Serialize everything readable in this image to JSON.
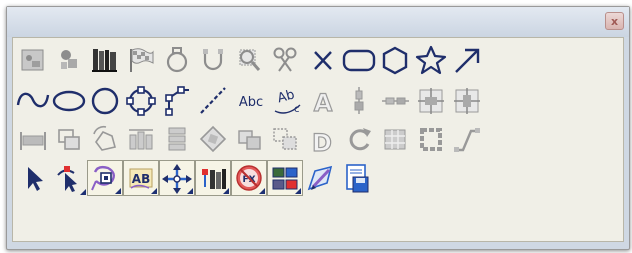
{
  "window": {
    "close_glyph": "x"
  },
  "text_tools": {
    "abc_label": "Abc",
    "ab_label": "Ab",
    "sub_label": "c",
    "outline_letter": "A",
    "d_letter": "D"
  },
  "badges": {
    "fx_label": "FX",
    "ab_label": "AB"
  },
  "colors": {
    "icon_dark": "#1f2e6b",
    "icon_gray": "#8d8d8d",
    "panel": "#f0efe7",
    "accent_red": "#e03030",
    "accent_purple": "#8a5fc6",
    "accent_blue": "#2b63c9"
  }
}
